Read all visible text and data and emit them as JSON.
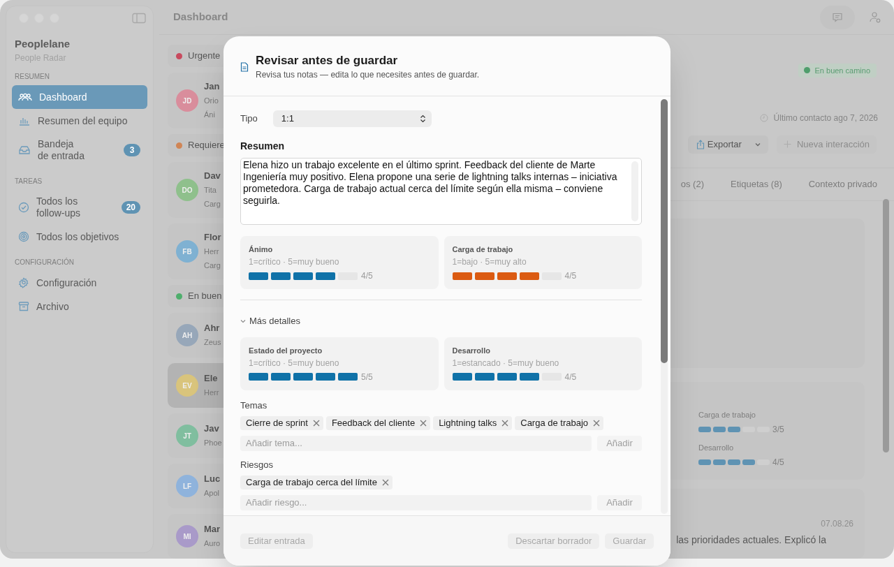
{
  "sidebar": {
    "app_name": "Peoplelane",
    "app_subtitle": "People Radar",
    "sections": [
      {
        "heading": "RESUMEN",
        "items": [
          {
            "label": "Dashboard",
            "kind": "people",
            "selected": true
          },
          {
            "label": "Resumen del equipo",
            "kind": "chart",
            "selected": false
          },
          {
            "label": "Bandeja\nde entrada",
            "kind": "inbox",
            "selected": false,
            "badge": "3"
          }
        ]
      },
      {
        "heading": "TAREAS",
        "items": [
          {
            "label": "Todos los\nfollow-ups",
            "kind": "check",
            "selected": false,
            "badge": "20"
          },
          {
            "label": "Todos los objetivos",
            "kind": "target",
            "selected": false
          }
        ]
      },
      {
        "heading": "CONFIGURACIÓN",
        "items": [
          {
            "label": "Configuración",
            "kind": "gear",
            "selected": false
          },
          {
            "label": "Archivo",
            "kind": "archive",
            "selected": false
          }
        ]
      }
    ]
  },
  "toolbar": {
    "title": "Dashboard"
  },
  "list": {
    "groups": [
      {
        "label": "Urgente",
        "color": "#c84a5e",
        "people": [
          {
            "initials": "JD",
            "color": "#d98d9c",
            "selected": false,
            "lines": [
              "Jan",
              "Orio",
              "Áni"
            ]
          }
        ]
      },
      {
        "label": "Requiere",
        "color": "#d08555",
        "people": [
          {
            "initials": "DO",
            "color": "#8fc08c",
            "selected": false,
            "lines": [
              "Dav",
              "Tita",
              "Carg"
            ]
          },
          {
            "initials": "FB",
            "color": "#7fb1d2",
            "selected": false,
            "lines": [
              "Flor",
              "Herr",
              "Carg"
            ]
          }
        ]
      },
      {
        "label": "En buen",
        "color": "#4eae6c",
        "people": [
          {
            "initials": "AH",
            "color": "#97a7b9",
            "selected": false,
            "lines": [
              "Ahr",
              "Zeus"
            ]
          },
          {
            "initials": "EV",
            "color": "#d9c47c",
            "selected": true,
            "lines": [
              "Ele",
              "Herr"
            ]
          },
          {
            "initials": "JT",
            "color": "#80be9f",
            "selected": false,
            "lines": [
              "Jav",
              "Phoe"
            ]
          },
          {
            "initials": "LF",
            "color": "#8fb3dc",
            "selected": false,
            "lines": [
              "Luc",
              "Apol"
            ]
          },
          {
            "initials": "MI",
            "color": "#a99ac9",
            "selected": false,
            "lines": [
              "Mar",
              "Auro"
            ]
          }
        ]
      }
    ]
  },
  "detail": {
    "status": "En buen camino",
    "last_contact": "Último contacto ago 7, 2026",
    "export_button": "Exportar",
    "new_button": {
      "label": "Nueva interacción",
      "disabled": true
    },
    "tabs": [
      {
        "label": "os (2)",
        "selected": false
      },
      {
        "label": "Etiquetas (8)",
        "selected": false
      },
      {
        "label": "Contexto privado",
        "selected": false
      }
    ],
    "ratings": [
      {
        "label": "Carga de trabajo",
        "stars": 3,
        "reading": "3/5"
      },
      {
        "label": "Desarrollo",
        "stars": 4,
        "reading": "4/5"
      }
    ],
    "entry": {
      "date": "07.08.26",
      "text": "las prioridades actuales. Explicó la"
    }
  },
  "dialog": {
    "title": "Revisar antes de guardar",
    "subtitle": "Revisa tus notas — edita lo que necesites antes de guardar.",
    "type": {
      "label": "Tipo",
      "value": "1:1"
    },
    "summary": {
      "label": "Resumen",
      "value": "Elena hizo un trabajo excelente en el último sprint. Feedback del cliente de Marte Ingeniería muy positivo. Elena propone una serie de lightning talks internas – iniciativa prometedora. Carga de trabajo actual cerca del límite según ella misma – conviene seguirla."
    },
    "ratings": [
      {
        "label": "Ánimo",
        "scale": "1=crítico · 5=muy bueno",
        "stars": 4,
        "reading": "4/5",
        "color": "#1072a8"
      },
      {
        "label": "Carga de trabajo",
        "scale": "1=bajo · 5=muy alto",
        "stars": 4,
        "reading": "4/5",
        "color": "#db5b12"
      }
    ],
    "more": {
      "label": "Más detalles",
      "expanded": true,
      "ratings": [
        {
          "label": "Estado del proyecto",
          "scale": "1=crítico · 5=muy bueno",
          "stars": 5,
          "reading": "5/5",
          "color": "#1072a8"
        },
        {
          "label": "Desarrollo",
          "scale": "1=estancado · 5=muy bueno",
          "stars": 4,
          "reading": "4/5",
          "color": "#1072a8"
        }
      ]
    },
    "topics": {
      "label": "Temas",
      "tags": [
        "Cierre de sprint",
        "Feedback del cliente",
        "Lightning talks",
        "Carga de trabajo"
      ],
      "placeholder": "Añadir tema...",
      "add_button": {
        "label": "Añadir",
        "disabled": true
      }
    },
    "risks": {
      "label": "Riesgos",
      "tags": [
        "Carga de trabajo cerca del límite"
      ],
      "placeholder": "Añadir riesgo...",
      "add_button": {
        "label": "Añadir",
        "disabled": true
      }
    },
    "buttons": [
      {
        "label": "Editar entrada",
        "disabled": true
      },
      {
        "label": "Descartar borrador",
        "disabled": true
      },
      {
        "label": "Guardar",
        "disabled": true
      }
    ]
  }
}
